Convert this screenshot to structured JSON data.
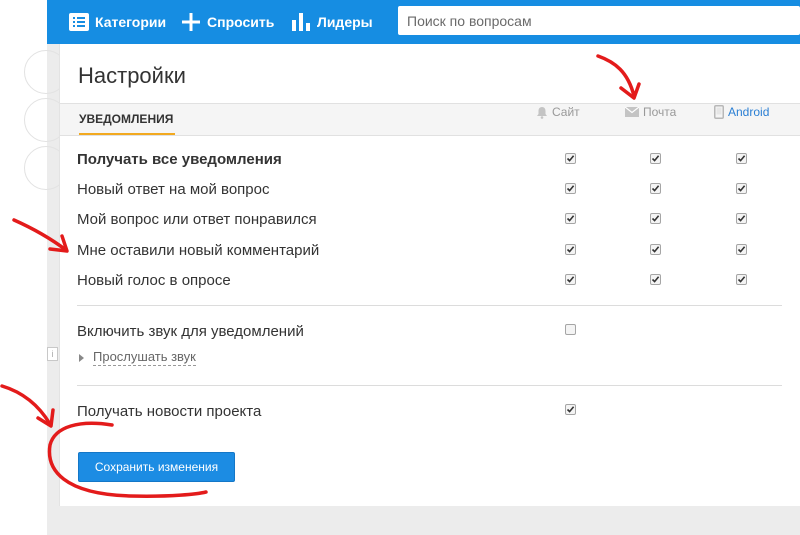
{
  "topbar": {
    "categories_label": "Категории",
    "ask_label": "Спросить",
    "leaders_label": "Лидеры",
    "search_placeholder": "Поиск по вопросам"
  },
  "settings": {
    "title": "Настройки",
    "tab_label": "УВЕДОМЛЕНИЯ",
    "columns": {
      "site": "Сайт",
      "mail": "Почта",
      "android": "Android"
    },
    "notifications": [
      {
        "label": "Получать все уведомления",
        "bold": true,
        "site": true,
        "mail": true,
        "android": true
      },
      {
        "label": "Новый ответ на мой вопрос",
        "site": true,
        "mail": true,
        "android": true
      },
      {
        "label": "Мой вопрос или ответ понравился",
        "site": true,
        "mail": true,
        "android": true
      },
      {
        "label": "Мне оставили новый комментарий",
        "site": true,
        "mail": true,
        "android": true
      },
      {
        "label": "Новый голос в опросе",
        "site": true,
        "mail": true,
        "android": true
      }
    ],
    "sound": {
      "label": "Включить звук для уведомлений",
      "checked": false,
      "listen_label": "Прослушать звук"
    },
    "news": {
      "label": "Получать новости проекта",
      "checked": true
    },
    "save_label": "Сохранить изменения"
  },
  "colors": {
    "topbar": "#168de2",
    "accent": "#1c8ce3",
    "tab_underline": "#f2a91f",
    "annotation": "#e31b1b"
  }
}
